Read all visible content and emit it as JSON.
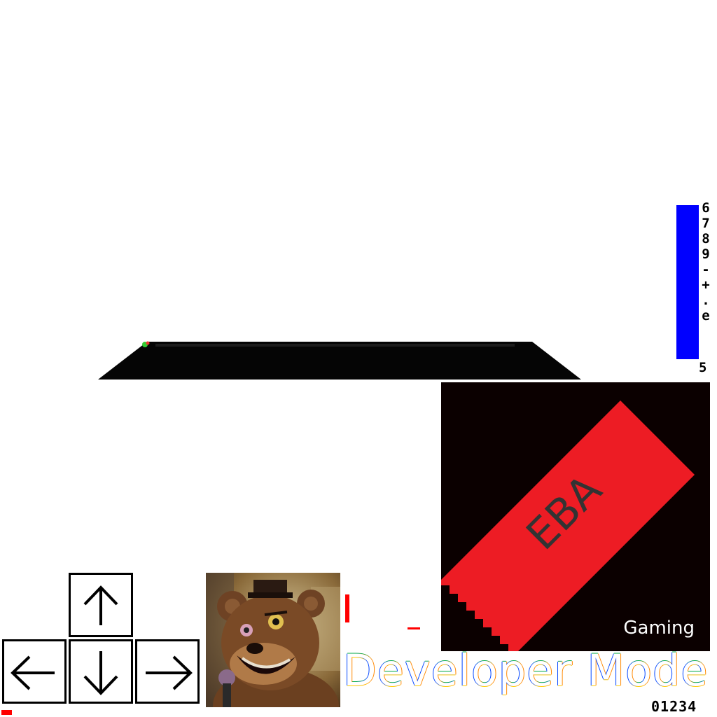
{
  "gauge": {
    "color": "#0000ff",
    "characters": [
      "6",
      "7",
      "8",
      "9",
      "-",
      "+",
      ".",
      "e"
    ],
    "value": "5"
  },
  "logo": {
    "text": "EBA",
    "subtitle": "Gaming",
    "background": "#0b0000",
    "banner_color": "#ed1c24"
  },
  "controls": {
    "keys": [
      "up-arrow-icon",
      "left-arrow-icon",
      "down-arrow-icon",
      "right-arrow-icon"
    ]
  },
  "status": {
    "mode_label": "Developer Mode",
    "counter": "01234"
  },
  "colors": {
    "marker": "#ff0000",
    "platform": "#050505"
  }
}
